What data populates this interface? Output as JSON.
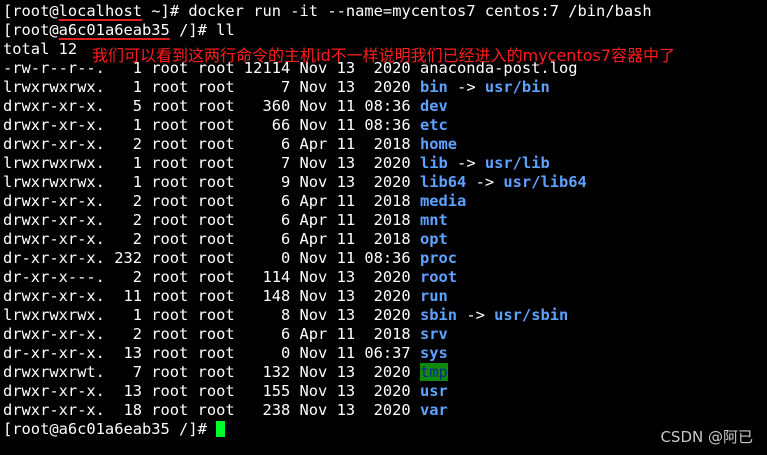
{
  "prompt1": {
    "open": "[root@",
    "host": "localhost",
    "rest": " ~]# docker run -it --name=mycentos7 centos:7 /bin/bash"
  },
  "prompt2": {
    "open": "[root@",
    "host": "a6c01a6eab35",
    "rest": " /]# ll"
  },
  "total": "total 12",
  "annotation": "我们可以看到这两行命令的主机id不一样说明我们已经进入的mycentos7容器中了",
  "listing": [
    {
      "meta": "-rw-r--r--.   1 root root 12114 Nov 13  2020 ",
      "name": "anaconda-post.log",
      "type": "file",
      "arrow": "",
      "target": ""
    },
    {
      "meta": "lrwxrwxrwx.   1 root root     7 Nov 13  2020 ",
      "name": "bin",
      "type": "dir",
      "arrow": " -> ",
      "target": "usr/bin"
    },
    {
      "meta": "drwxr-xr-x.   5 root root   360 Nov 11 08:36 ",
      "name": "dev",
      "type": "dir",
      "arrow": "",
      "target": ""
    },
    {
      "meta": "drwxr-xr-x.   1 root root    66 Nov 11 08:36 ",
      "name": "etc",
      "type": "dir",
      "arrow": "",
      "target": ""
    },
    {
      "meta": "drwxr-xr-x.   2 root root     6 Apr 11  2018 ",
      "name": "home",
      "type": "dir",
      "arrow": "",
      "target": ""
    },
    {
      "meta": "lrwxrwxrwx.   1 root root     7 Nov 13  2020 ",
      "name": "lib",
      "type": "dir",
      "arrow": " -> ",
      "target": "usr/lib"
    },
    {
      "meta": "lrwxrwxrwx.   1 root root     9 Nov 13  2020 ",
      "name": "lib64",
      "type": "dir",
      "arrow": " -> ",
      "target": "usr/lib64"
    },
    {
      "meta": "drwxr-xr-x.   2 root root     6 Apr 11  2018 ",
      "name": "media",
      "type": "dir",
      "arrow": "",
      "target": ""
    },
    {
      "meta": "drwxr-xr-x.   2 root root     6 Apr 11  2018 ",
      "name": "mnt",
      "type": "dir",
      "arrow": "",
      "target": ""
    },
    {
      "meta": "drwxr-xr-x.   2 root root     6 Apr 11  2018 ",
      "name": "opt",
      "type": "dir",
      "arrow": "",
      "target": ""
    },
    {
      "meta": "dr-xr-xr-x. 232 root root     0 Nov 11 08:36 ",
      "name": "proc",
      "type": "dir",
      "arrow": "",
      "target": ""
    },
    {
      "meta": "dr-xr-x---.   2 root root   114 Nov 13  2020 ",
      "name": "root",
      "type": "dir",
      "arrow": "",
      "target": ""
    },
    {
      "meta": "drwxr-xr-x.  11 root root   148 Nov 13  2020 ",
      "name": "run",
      "type": "dir",
      "arrow": "",
      "target": ""
    },
    {
      "meta": "lrwxrwxrwx.   1 root root     8 Nov 13  2020 ",
      "name": "sbin",
      "type": "dir",
      "arrow": " -> ",
      "target": "usr/sbin"
    },
    {
      "meta": "drwxr-xr-x.   2 root root     6 Apr 11  2018 ",
      "name": "srv",
      "type": "dir",
      "arrow": "",
      "target": ""
    },
    {
      "meta": "dr-xr-xr-x.  13 root root     0 Nov 11 06:37 ",
      "name": "sys",
      "type": "dir",
      "arrow": "",
      "target": ""
    },
    {
      "meta": "drwxrwxrwt.   7 root root   132 Nov 13  2020 ",
      "name": "tmp",
      "type": "tmp",
      "arrow": "",
      "target": ""
    },
    {
      "meta": "drwxr-xr-x.  13 root root   155 Nov 13  2020 ",
      "name": "usr",
      "type": "dir",
      "arrow": "",
      "target": ""
    },
    {
      "meta": "drwxr-xr-x.  18 root root   238 Nov 13  2020 ",
      "name": "var",
      "type": "dir",
      "arrow": "",
      "target": ""
    }
  ],
  "prompt3": "[root@a6c01a6eab35 /]# ",
  "watermark": "CSDN @阿已",
  "colors": {
    "background": "#000000",
    "directory": "#5ea2ff",
    "annotation": "#ff1c1c",
    "cursor": "#00ff2a",
    "tmp_highlight": "#0f8a0f"
  }
}
